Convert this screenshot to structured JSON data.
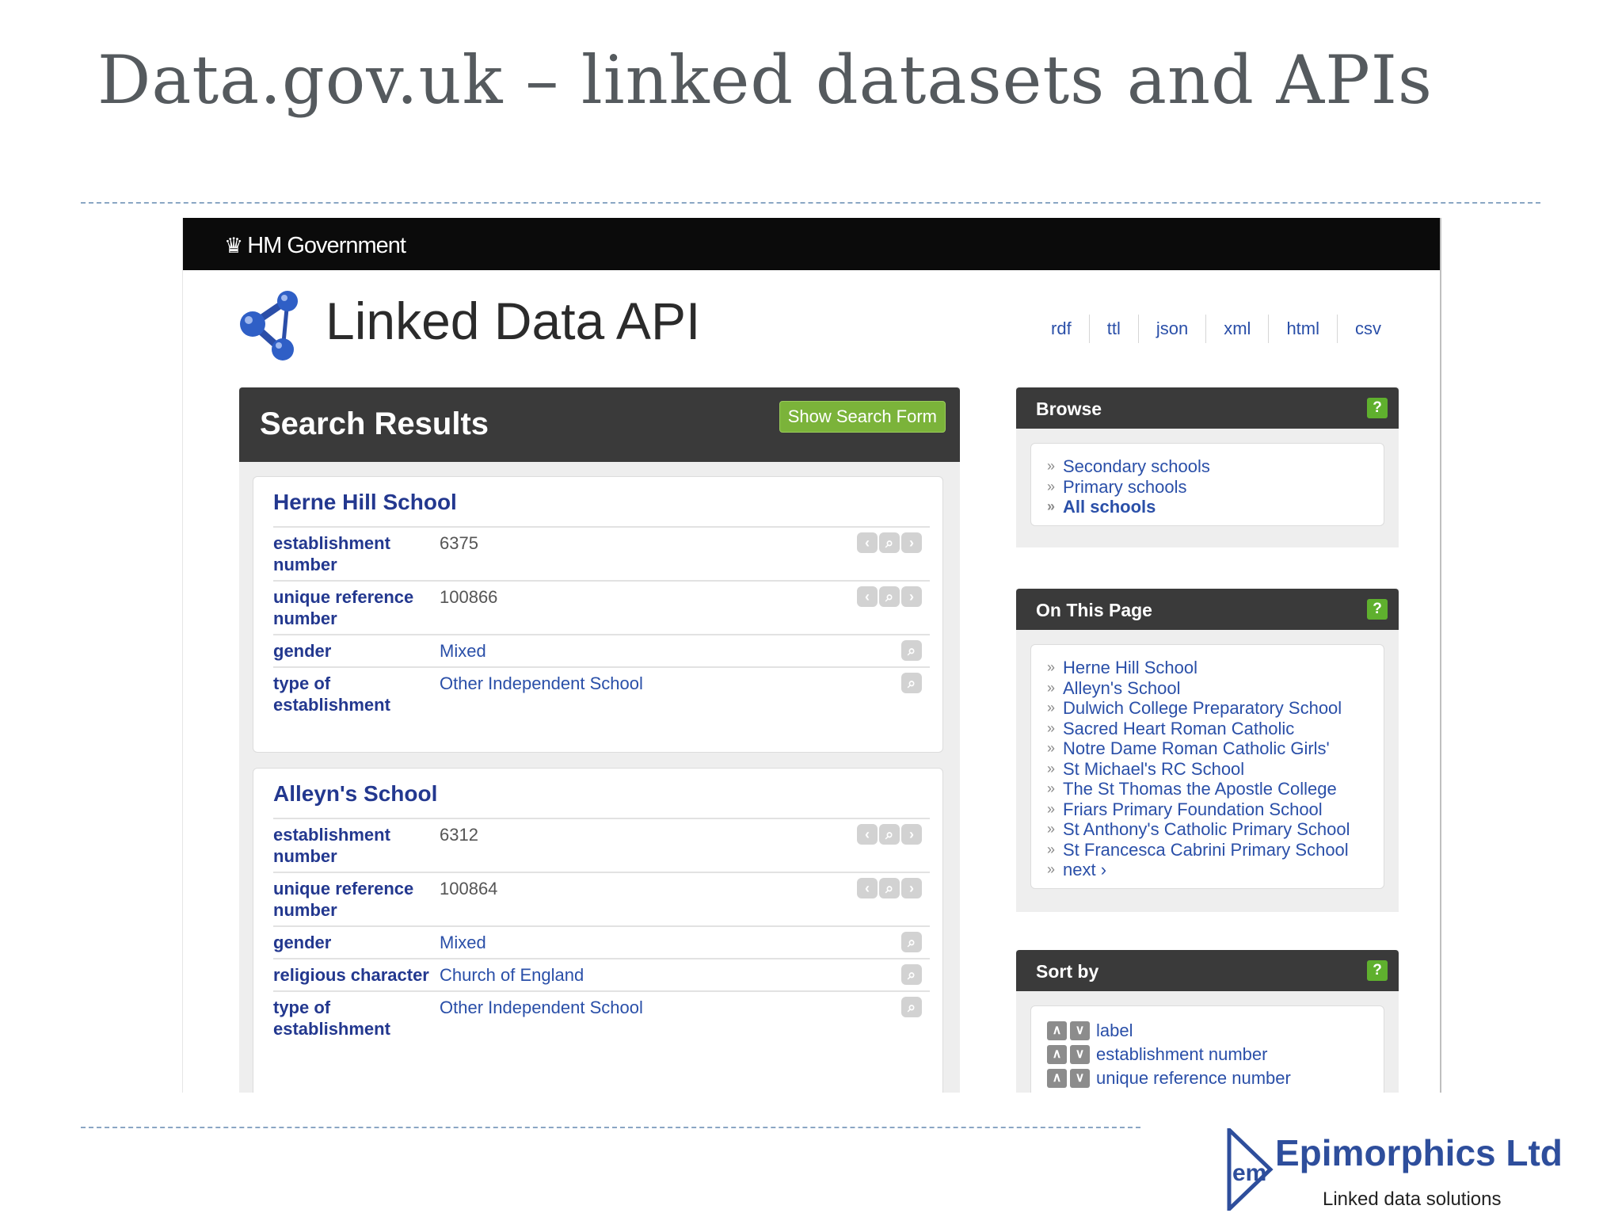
{
  "slide": {
    "title": "Data.gov.uk – linked datasets and APIs"
  },
  "gov_bar": {
    "logo_text": "HM Government"
  },
  "api": {
    "title": "Linked Data API"
  },
  "formats": [
    "rdf",
    "ttl",
    "json",
    "xml",
    "html",
    "csv"
  ],
  "results": {
    "title": "Search Results",
    "show_search_form": "Show Search Form",
    "items": [
      {
        "name": "Herne Hill School",
        "props": [
          {
            "label": "establishment number",
            "value": "6375",
            "icons": [
              "<",
              "search",
              ">"
            ]
          },
          {
            "label": "unique reference number",
            "value": "100866",
            "icons": [
              "<",
              "search",
              ">"
            ]
          },
          {
            "label": "gender",
            "value": "Mixed",
            "icons": [
              "search"
            ]
          },
          {
            "label": "type of establishment",
            "value": "Other Independent School",
            "icons": [
              "search"
            ]
          }
        ]
      },
      {
        "name": "Alleyn's School",
        "props": [
          {
            "label": "establishment number",
            "value": "6312",
            "icons": [
              "<",
              "search",
              ">"
            ]
          },
          {
            "label": "unique reference number",
            "value": "100864",
            "icons": [
              "<",
              "search",
              ">"
            ]
          },
          {
            "label": "gender",
            "value": "Mixed",
            "icons": [
              "search"
            ]
          },
          {
            "label": "religious character",
            "value": "Church of England",
            "icons": [
              "search"
            ]
          },
          {
            "label": "type of establishment",
            "value": "Other Independent School",
            "icons": [
              "search"
            ]
          }
        ]
      }
    ]
  },
  "browse": {
    "title": "Browse",
    "help": "?",
    "items": [
      "Secondary schools",
      "Primary schools",
      "All schools"
    ]
  },
  "on_this_page": {
    "title": "On This Page",
    "help": "?",
    "items": [
      "Herne Hill School",
      "Alleyn's School",
      "Dulwich College Preparatory School",
      "Sacred Heart Roman Catholic",
      "Notre Dame Roman Catholic Girls'",
      "St Michael's RC School",
      "The St Thomas the Apostle College",
      "Friars Primary Foundation School",
      "St Anthony's Catholic Primary School",
      "St Francesca Cabrini Primary School",
      "next ›"
    ]
  },
  "sort_by": {
    "title": "Sort by",
    "help": "?",
    "items": [
      "label",
      "establishment number",
      "unique reference number"
    ]
  },
  "company": {
    "name": "Epimorphics Ltd",
    "tagline": "Linked data solutions",
    "mark_letters": "em"
  },
  "colors": {
    "link": "#2a4fa8",
    "heading": "#23388f",
    "panel_dark": "#3a3a3a",
    "accent_green": "#7bb33a",
    "brand_blue": "#2e4e9c"
  }
}
